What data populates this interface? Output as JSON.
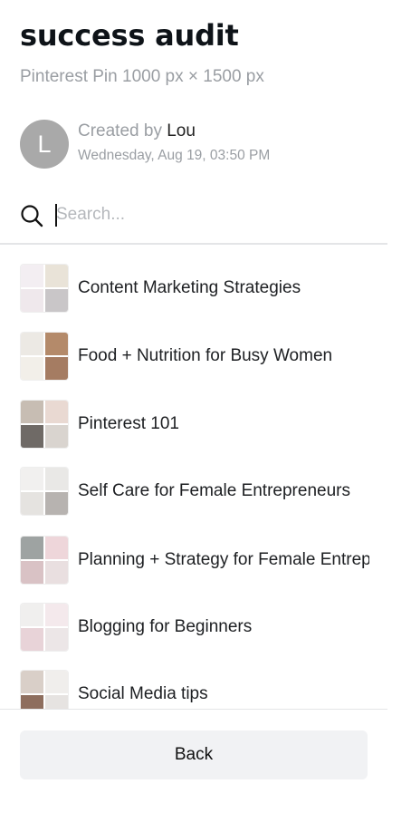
{
  "header": {
    "title": "success audit",
    "subtitle": "Pinterest Pin 1000 px × 1500 px",
    "avatar_initial": "L",
    "created_prefix": "Created by",
    "author": "Lou",
    "date": "Wednesday, Aug 19, 03:50 PM"
  },
  "search": {
    "placeholder": "Search...",
    "value": ""
  },
  "folders": [
    {
      "label": "Content Marketing Strategies",
      "thumb_colors": [
        "#f3eef2",
        "#e9e3d8",
        "#efe8ec",
        "#c9c6c8"
      ]
    },
    {
      "label": "Food + Nutrition for Busy Women",
      "thumb_colors": [
        "#ece9e4",
        "#b48a6a",
        "#f2efe9",
        "#a57c62"
      ]
    },
    {
      "label": "Pinterest 101",
      "thumb_colors": [
        "#c7bdb3",
        "#e9d9d2",
        "#6f6a66",
        "#d9d4cf"
      ]
    },
    {
      "label": "Self Care for Female Entrepreneurs",
      "thumb_colors": [
        "#f1f0ef",
        "#e9e8e6",
        "#e5e3e0",
        "#b7b3b0"
      ]
    },
    {
      "label": "Planning + Strategy for Female Entrepreneurs",
      "thumb_colors": [
        "#9ea3a2",
        "#eed6da",
        "#d9c2c5",
        "#e9dfe0"
      ]
    },
    {
      "label": "Blogging for Beginners",
      "thumb_colors": [
        "#f0efee",
        "#f4e9ec",
        "#e8d3d8",
        "#ece6e7"
      ]
    },
    {
      "label": "Social Media tips",
      "thumb_colors": [
        "#d9cfc8",
        "#f0eeec",
        "#8e6e5e",
        "#e6e3e1"
      ]
    }
  ],
  "footer": {
    "back_label": "Back"
  },
  "icons": {
    "search": "search-icon"
  }
}
